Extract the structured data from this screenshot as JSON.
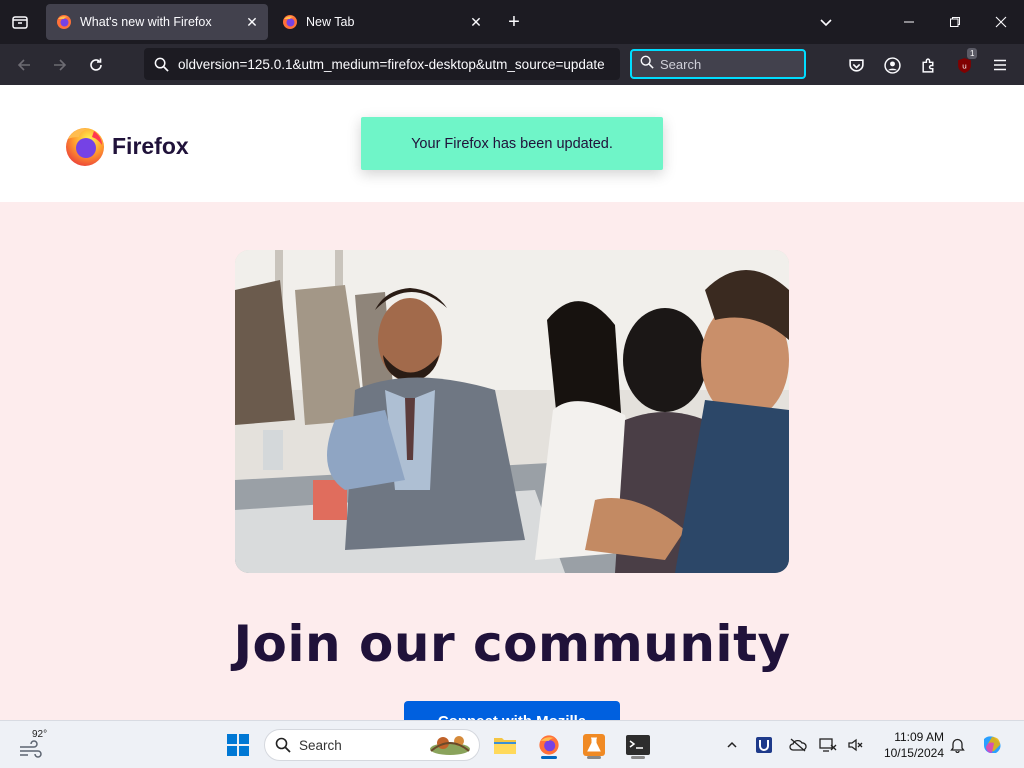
{
  "browser": {
    "tabs": [
      {
        "title": "What's new with Firefox",
        "active": true
      },
      {
        "title": "New Tab",
        "active": false
      }
    ],
    "address": "oldversion=125.0.1&utm_medium=firefox-desktop&utm_source=update",
    "search_placeholder": "Search",
    "ublock_badge": "1",
    "icons": {
      "tab_list": "tab-list-icon",
      "new_tab": "plus-icon",
      "tab_overflow": "chevron-down-icon",
      "back": "back-arrow-icon",
      "forward": "forward-arrow-icon",
      "reload": "reload-icon",
      "pocket": "pocket-icon",
      "account": "account-icon",
      "extensions": "extensions-icon",
      "ublock": "ublock-origin-icon",
      "menu": "hamburger-menu-icon"
    },
    "colors": {
      "accent": "#00ddff",
      "toolbar": "#2b2a33",
      "tabstrip": "#1c1b22"
    }
  },
  "page": {
    "logo_text": "Firefox",
    "notification": "Your Firefox has been updated.",
    "heading": "Join our community",
    "cta_label": "Connect with Mozilla",
    "colors": {
      "notification_bg": "#6ff5c8",
      "page_bg": "#fdeced",
      "cta_bg": "#0060df",
      "heading": "#20123a"
    }
  },
  "taskbar": {
    "temperature": "92°",
    "search_placeholder": "Search",
    "time": "11:09 AM",
    "date": "10/15/2024"
  }
}
